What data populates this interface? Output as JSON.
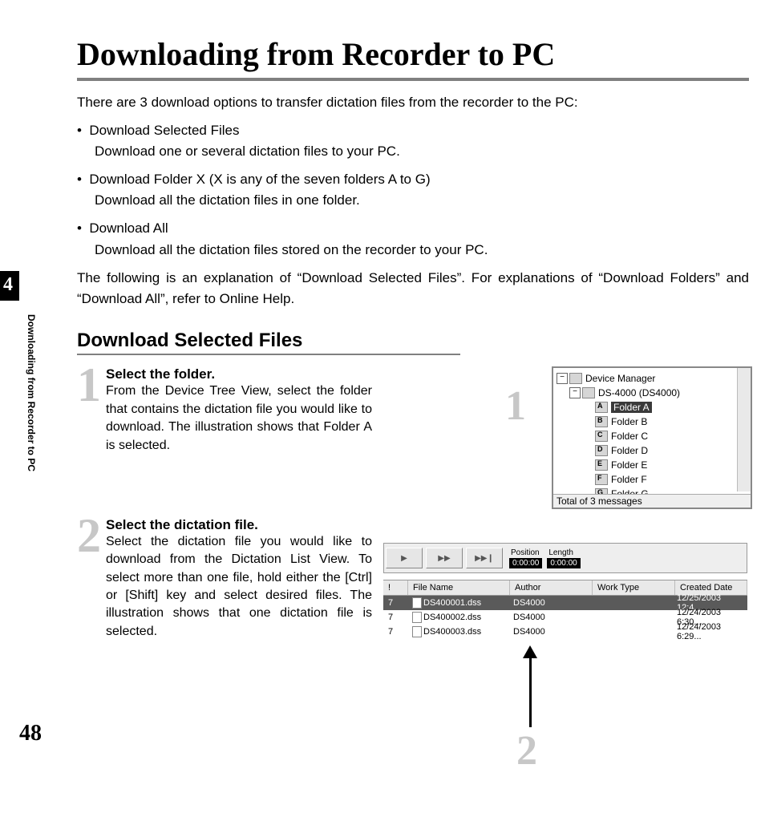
{
  "page": {
    "title": "Downloading from Recorder to PC",
    "number": "48",
    "chapter_tab": "4",
    "side_label": "Downloading from Recorder to PC"
  },
  "intro": "There are 3 download options to transfer dictation files from the recorder to the PC:",
  "bullets": [
    {
      "lead": "Download Selected Files",
      "sub": "Download one or several dictation files to your PC."
    },
    {
      "lead": "Download Folder X (X is any of the seven folders A to G)",
      "sub": "Download all the dictation files in one folder."
    },
    {
      "lead": "Download All",
      "sub": "Download all the dictation files stored on the recorder to your PC."
    }
  ],
  "note": "The following is an explanation of “Download Selected Files”. For explanations of “Download Folders” and “Download All”, refer to Online Help.",
  "section": "Download Selected Files",
  "steps": [
    {
      "n": "1",
      "head": "Select the folder.",
      "body": "From the Device Tree View, select the folder that contains the dictation file you would like to download. The illustration shows that Folder A is selected."
    },
    {
      "n": "2",
      "head": "Select the dictation file.",
      "body": "Select the dictation file you would like to download from the Dictation List View. To select more than one file, hold either the [Ctrl] or [Shift] key and select desired files. The illustration shows that one dictation file is selected."
    }
  ],
  "tree": {
    "root": "Device Manager",
    "device": "DS-4000 (DS4000)",
    "folders": [
      {
        "l": "A",
        "name": "Folder A",
        "selected": true
      },
      {
        "l": "B",
        "name": "Folder B"
      },
      {
        "l": "C",
        "name": "Folder C"
      },
      {
        "l": "D",
        "name": "Folder D"
      },
      {
        "l": "E",
        "name": "Folder E"
      },
      {
        "l": "F",
        "name": "Folder F"
      },
      {
        "l": "G",
        "name": "Folder G"
      }
    ],
    "status": "Total of 3 messages"
  },
  "player": {
    "position_label": "Position",
    "position": "0:00:00",
    "length_label": "Length",
    "length": "0:00:00",
    "buttons": [
      "▶",
      "▶▶",
      "▶▶❙"
    ]
  },
  "list": {
    "columns": {
      "pri": "!",
      "fn": "File Name",
      "au": "Author",
      "wt": "Work Type",
      "cd": "Created Date"
    },
    "rows": [
      {
        "pri": "7",
        "fn": "DS400001.dss",
        "au": "DS4000",
        "wt": "",
        "cd": "12/25/2003 12:4...",
        "selected": true
      },
      {
        "pri": "7",
        "fn": "DS400002.dss",
        "au": "DS4000",
        "wt": "",
        "cd": "12/24/2003 6:30..."
      },
      {
        "pri": "7",
        "fn": "DS400003.dss",
        "au": "DS4000",
        "wt": "",
        "cd": "12/24/2003 6:29..."
      }
    ]
  },
  "callouts": {
    "one": "1",
    "two": "2"
  }
}
